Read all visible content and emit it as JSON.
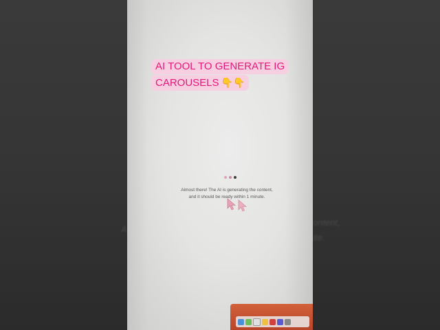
{
  "caption": {
    "line1": "AI TOOL TO GENERATE IG",
    "line2": "CAROUSELS",
    "emoji": "👇👇"
  },
  "status": {
    "line1": "Almost there! The AI is generating the content,",
    "line2": "and it should be ready within 1 minute."
  },
  "background_echo": {
    "right1": "ontent,",
    "right2": "ite."
  },
  "colors": {
    "caption_bg": "#f6cfe0",
    "caption_text": "#e0197a",
    "screen_bg": "#e8e8e6",
    "dock": "#c8502f"
  },
  "icons": [
    "loading-dots-icon",
    "cursor-arrow-icon",
    "cursor-arrow-icon"
  ]
}
